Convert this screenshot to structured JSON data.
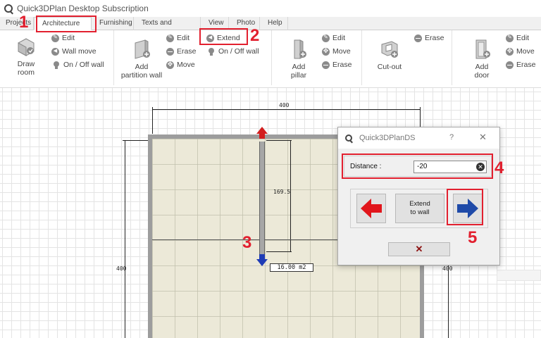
{
  "window": {
    "title": "Quick3DPlan Desktop Subscription"
  },
  "tabs": [
    {
      "label": "Projects"
    },
    {
      "label": "Architecture"
    },
    {
      "label": "Furnishing"
    },
    {
      "label": "Texts and shapes"
    },
    {
      "label": "View"
    },
    {
      "label": "Photo"
    },
    {
      "label": "Help"
    }
  ],
  "ribbon": {
    "draw_room": "Draw\nroom",
    "draw_room_l1": "Draw",
    "draw_room_l2": "room",
    "wall_edit": "Edit",
    "wall_move": "Wall move",
    "wall_onoff": "On / Off wall",
    "partition_l1": "Add",
    "partition_l2": "partition wall",
    "partition_edit": "Edit",
    "partition_erase": "Erase",
    "partition_move": "Move",
    "extend": "Extend",
    "onoff_wall": "On / Off wall",
    "pillar_l1": "Add",
    "pillar_l2": "pillar",
    "pillar_edit": "Edit",
    "pillar_move": "Move",
    "pillar_erase": "Erase",
    "cutout": "Cut-out",
    "cutout_erase": "Erase",
    "door_l1": "Add",
    "door_l2": "door",
    "door_edit": "Edit",
    "door_move": "Move",
    "door_erase": "Erase"
  },
  "canvas": {
    "dim_top": "400",
    "dim_left": "400",
    "dim_right": "400",
    "dim_partition": "169.5",
    "area": "16.00 m2"
  },
  "dialog": {
    "title": "Quick3DPlanDS",
    "help": "?",
    "close": "✕",
    "distance_label": "Distance :",
    "distance_value": "-20",
    "extend_l1": "Extend",
    "extend_l2": "to wall",
    "cancel_glyph": "✕"
  },
  "callouts": [
    "1",
    "2",
    "3",
    "4",
    "5"
  ],
  "colors": {
    "highlight": "#e2202f",
    "arrow_red": "#d21e1e",
    "arrow_blue": "#1f3cb6"
  }
}
